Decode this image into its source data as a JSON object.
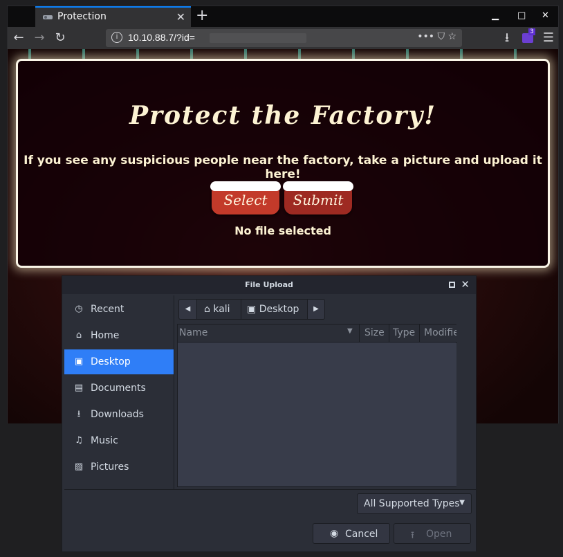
{
  "browser": {
    "tab_title": "Protection",
    "tab_close": "✕",
    "new_tab": "+",
    "window_controls": [
      "▁",
      "□",
      "✕"
    ],
    "nav": {
      "back": "←",
      "forward": "→",
      "reload": "↻"
    },
    "url": "10.10.88.7/?id=",
    "url_actions": "••• ⛉ ☆",
    "downloads_icon": "⭳",
    "extension_badge": "3",
    "menu_icon": "☰"
  },
  "page": {
    "title": "Protect the Factory!",
    "instructions": "If you see any suspicious people near the factory, take a picture and upload it here!",
    "select_label": "Select",
    "submit_label": "Submit",
    "status": "No file selected"
  },
  "dialog": {
    "title": "File Upload",
    "close_glyph": "✕",
    "places": [
      {
        "label": "Recent",
        "icon": "clock-icon",
        "glyph": "◷"
      },
      {
        "label": "Home",
        "icon": "home-icon",
        "glyph": "⌂"
      },
      {
        "label": "Desktop",
        "icon": "desktop-icon",
        "glyph": "▣"
      },
      {
        "label": "Documents",
        "icon": "document-icon",
        "glyph": "▤"
      },
      {
        "label": "Downloads",
        "icon": "download-icon",
        "glyph": "⭳"
      },
      {
        "label": "Music",
        "icon": "music-icon",
        "glyph": "♫"
      },
      {
        "label": "Pictures",
        "icon": "picture-icon",
        "glyph": "▨"
      }
    ],
    "path": {
      "left_arrow": "◀",
      "home_glyph": "⌂",
      "home": "kali",
      "desktop_glyph": "▣",
      "current": "Desktop",
      "right_arrow": "▶"
    },
    "columns": {
      "name": "Name",
      "sort_glyph": "▼",
      "size": "Size",
      "type": "Type",
      "modified": "Modifie"
    },
    "filter": {
      "label": "All Supported Types",
      "arrow": "▼"
    },
    "cancel": {
      "label": "Cancel",
      "glyph": "◉"
    },
    "open": {
      "label": "Open",
      "glyph": "⭱"
    }
  },
  "colors": {
    "accent": "#2f7ef7",
    "page_text": "#fdf3d3",
    "button_red": "#c33a2a"
  }
}
